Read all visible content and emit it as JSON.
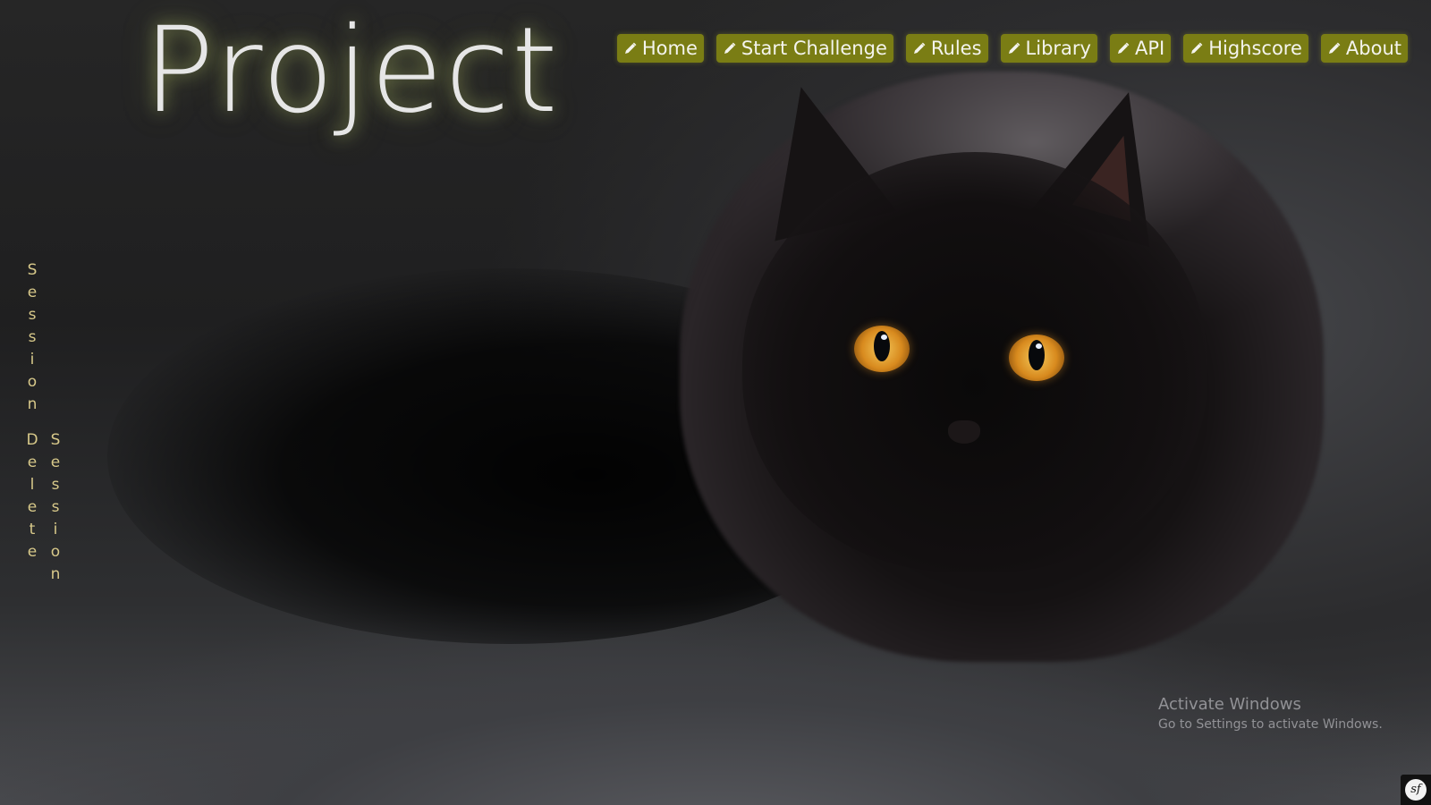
{
  "logo": {
    "text": "Project"
  },
  "nav": {
    "items": [
      {
        "label": "Home",
        "icon": "pencil-icon"
      },
      {
        "label": "Start Challenge",
        "icon": "pencil-icon"
      },
      {
        "label": "Rules",
        "icon": "pencil-icon"
      },
      {
        "label": "Library",
        "icon": "pencil-icon"
      },
      {
        "label": "API",
        "icon": "pencil-icon"
      },
      {
        "label": "Highscore",
        "icon": "pencil-icon"
      },
      {
        "label": "About",
        "icon": "pencil-icon"
      }
    ],
    "button_color": "#7a7d14"
  },
  "sidebar": {
    "session_link": "Session",
    "delete_session_link": {
      "word1": "Delete",
      "word2": "Session"
    },
    "link_color": "#d8c98a"
  },
  "watermark": {
    "title": "Activate Windows",
    "subtitle": "Go to Settings to activate Windows."
  },
  "corner_badge": {
    "icon": "symfony-icon",
    "text": "sf"
  }
}
